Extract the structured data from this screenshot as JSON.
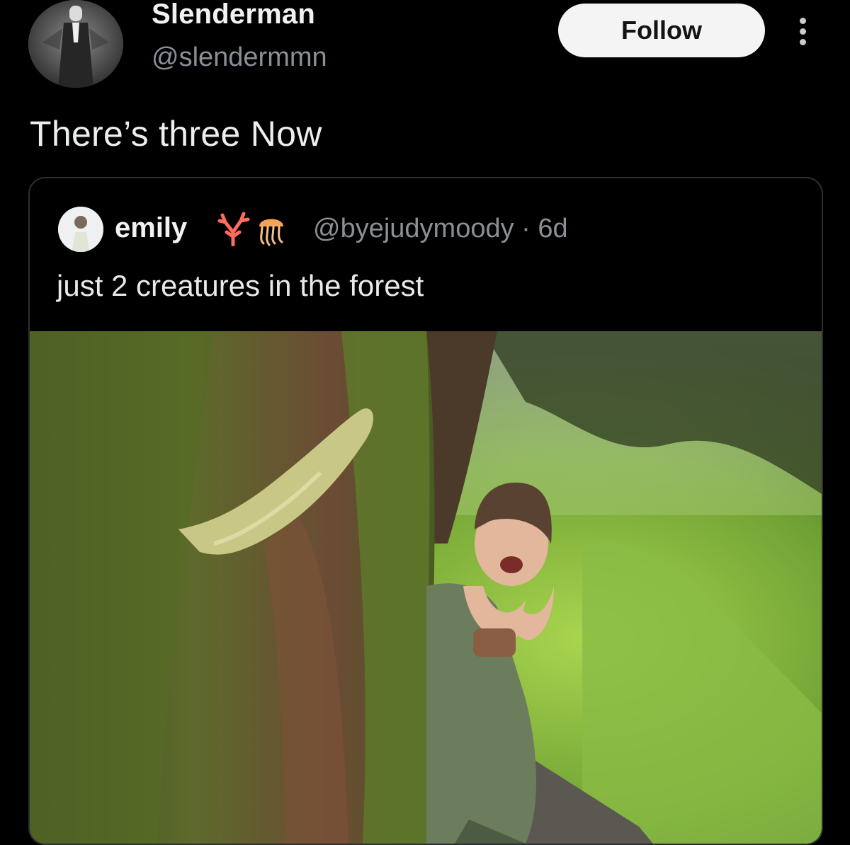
{
  "post": {
    "author_name": "Slenderman",
    "author_handle": "@slendermmn",
    "follow_label": "Follow",
    "text": "There’s three Now"
  },
  "quoted": {
    "name": "emily",
    "emojis": [
      "coral-icon",
      "jellyfish-icon"
    ],
    "handle_time": "@byejudymoody · 6d",
    "text": "just 2 creatures in the forest"
  },
  "colors": {
    "background": "#000000",
    "follow_button_bg": "#f4f4f4",
    "handle_gray": "#8b9096",
    "card_border": "#2b2f33"
  }
}
